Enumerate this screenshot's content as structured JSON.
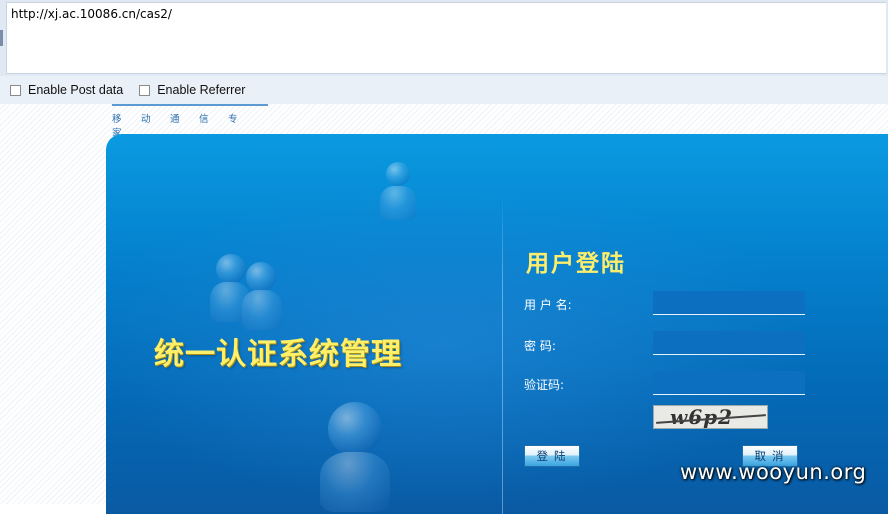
{
  "toolbar": {
    "url_value": "http://xj.ac.10086.cn/cas2/",
    "enable_post_label": "Enable Post data",
    "enable_referrer_label": "Enable Referrer"
  },
  "site": {
    "logo_chars": [
      "移",
      "动",
      "通",
      "信",
      "专",
      "家"
    ],
    "system_title": "统一认证系统管理"
  },
  "login": {
    "title": "用户登陆",
    "username_label": "用 户 名:",
    "password_label": "密 码:",
    "captcha_label": "验证码:",
    "username_value": "",
    "password_value": "",
    "captcha_value": "",
    "captcha_image_text": "w6p2",
    "login_button": "登陆",
    "cancel_button": "取消"
  },
  "watermark": "www.wooyun.org",
  "colors": {
    "panel_blue": "#0583cf",
    "title_yellow": "#fff06a"
  }
}
